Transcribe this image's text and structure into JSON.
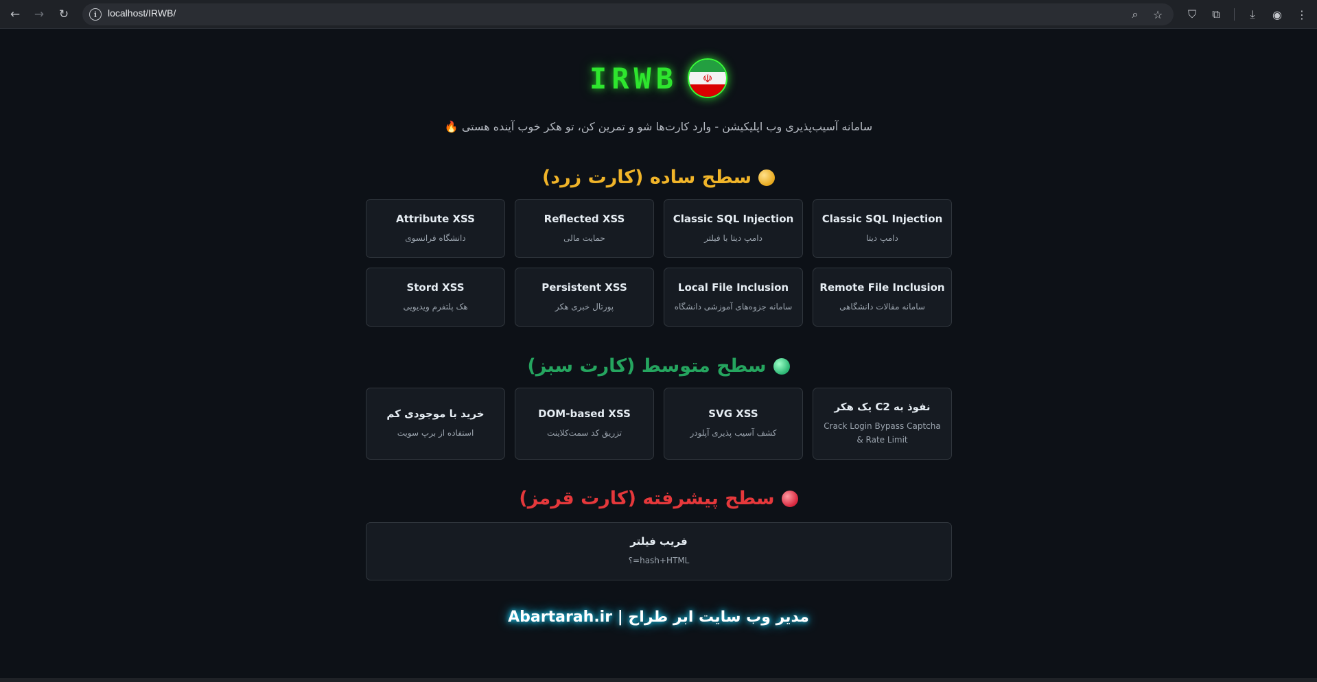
{
  "browser": {
    "url": "localhost/IRWB/"
  },
  "header": {
    "brand": "IRWB",
    "flag_emblem": "☫",
    "subtitle": "سامانه آسیب‌پذیری وب اپلیکیشن - وارد کارت‌ها شو و تمرین کن، تو هکر خوب آینده هستی 🔥"
  },
  "sections": [
    {
      "title": "سطح ساده (کارت زرد)",
      "color": "#f0b429",
      "cards": [
        {
          "title": "Classic SQL Injection",
          "sub": "دامپ دیتا"
        },
        {
          "title": "Classic SQL Injection",
          "sub": "دامپ دیتا با فیلتر"
        },
        {
          "title": "Reflected XSS",
          "sub": "حمایت مالی"
        },
        {
          "title": "Attribute XSS",
          "sub": "دانشگاه فرانسوی"
        },
        {
          "title": "Remote File Inclusion",
          "sub": "سامانه مقالات دانشگاهی"
        },
        {
          "title": "Local File Inclusion",
          "sub": "سامانه جزوه‌های آموزشی دانشگاه"
        },
        {
          "title": "Persistent XSS",
          "sub": "پورتال خبری هکر"
        },
        {
          "title": "Stord XSS",
          "sub": "هک پلتفرم ویدیویی"
        }
      ]
    },
    {
      "title": "سطح متوسط (کارت سبز)",
      "color": "#25a55f",
      "cards": [
        {
          "title": "نفوذ به C2 یک هکر",
          "sub": "Crack Login Bypass Captcha & Rate Limit"
        },
        {
          "title": "SVG XSS",
          "sub": "کشف آسیب پذیری آپلودر"
        },
        {
          "title": "DOM-based XSS",
          "sub": "تزریق کد سمت‌کلاینت"
        },
        {
          "title": "خرید با موجودی کم",
          "sub": "استفاده از برپ سویت"
        }
      ]
    },
    {
      "title": "سطح پیشرفته (کارت قرمز)",
      "color": "#e5383b",
      "cards": [
        {
          "title": "فریب فیلتر",
          "sub": "hash+HTML=؟"
        }
      ]
    }
  ],
  "footer": "مدیر وب سایت ابر طراح | Abartarah.ir"
}
